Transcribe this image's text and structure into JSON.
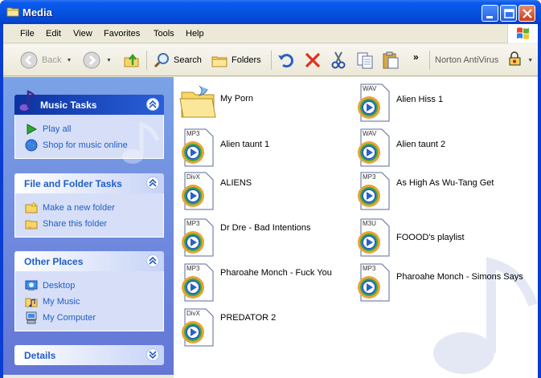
{
  "window": {
    "title": "Media"
  },
  "menu": [
    "File",
    "Edit",
    "View",
    "Favorites",
    "Tools",
    "Help"
  ],
  "toolbar": {
    "back_label": "Back",
    "search_label": "Search",
    "folders_label": "Folders",
    "more_label": "»",
    "norton_label": "Norton AntiVirus"
  },
  "tasks": {
    "music": {
      "title": "Music Tasks",
      "items": [
        "Play all",
        "Shop for music online"
      ]
    },
    "file_folder": {
      "title": "File and Folder Tasks",
      "items": [
        "Make a new folder",
        "Share this folder"
      ]
    },
    "other": {
      "title": "Other Places",
      "items": [
        "Desktop",
        "My Music",
        "My Computer"
      ]
    },
    "details": {
      "title": "Details"
    }
  },
  "files": [
    {
      "name": "My Porn",
      "type": "folder",
      "badge": ""
    },
    {
      "name": "Alien Hiss 1",
      "type": "media",
      "badge": "WAV"
    },
    {
      "name": "Alien taunt 1",
      "type": "media",
      "badge": "MP3"
    },
    {
      "name": "Alien taunt 2",
      "type": "media",
      "badge": "WAV"
    },
    {
      "name": "ALIENS",
      "type": "media",
      "badge": "DivX"
    },
    {
      "name": "As High As Wu-Tang Get",
      "type": "media",
      "badge": "MP3"
    },
    {
      "name": "Dr Dre - Bad Intentions",
      "type": "media",
      "badge": "MP3"
    },
    {
      "name": "FOOOD's playlist",
      "type": "media",
      "badge": "M3U"
    },
    {
      "name": "Pharoahe Monch - Fuck You",
      "type": "media",
      "badge": "MP3"
    },
    {
      "name": "Pharoahe Monch - Simons Says",
      "type": "media",
      "badge": "MP3"
    },
    {
      "name": "PREDATOR 2",
      "type": "media",
      "badge": "DivX"
    }
  ],
  "colors": {
    "title_bar": "#0553e0",
    "task_pane": "#6f8fdf",
    "task_link": "#215dc6"
  }
}
